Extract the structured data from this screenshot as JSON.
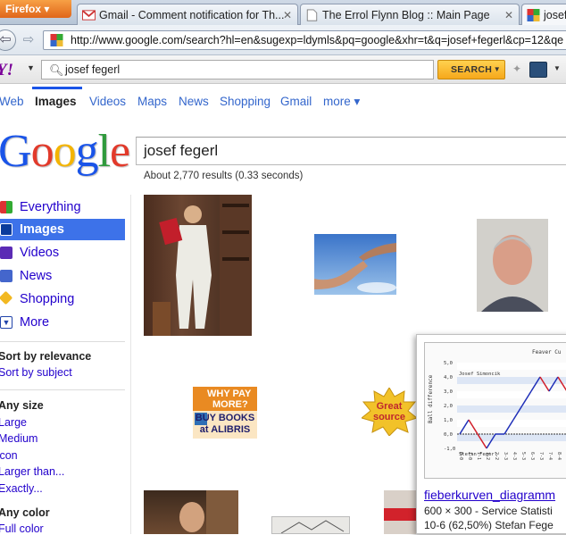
{
  "browser": {
    "app_button": "Firefox",
    "tabs": [
      {
        "label": "Gmail - Comment notification for Th...",
        "icon": "gmail-icon"
      },
      {
        "label": "The Errol Flynn Blog :: Main Page",
        "icon": "page-icon"
      },
      {
        "label": "josef",
        "icon": "google-icon"
      }
    ],
    "url": "http://www.google.com/search?hl=en&sugexp=ldymls&pq=google&xhr=t&q=josef+fegerl&cp=12&qe"
  },
  "yahoo_toolbar": {
    "logo": "Y!",
    "search_value": "josef fegerl",
    "search_button": "SEARCH"
  },
  "google_nav": {
    "items": [
      "Web",
      "Images",
      "Videos",
      "Maps",
      "News",
      "Shopping",
      "Gmail",
      "more ▾"
    ],
    "active": "Images"
  },
  "search": {
    "query": "josef fegerl",
    "stats": "About 2,770 results (0.33 seconds)"
  },
  "left_nav": {
    "types": [
      "Everything",
      "Images",
      "Videos",
      "News",
      "Shopping",
      "More"
    ],
    "sort_heading": "Sort by relevance",
    "sort_link": "Sort by subject",
    "size_heading": "Any size",
    "size_links": [
      "Large",
      "Medium",
      "Icon",
      "Larger than...",
      "Exactly..."
    ],
    "color_heading": "Any color",
    "color_links": [
      "Full color"
    ]
  },
  "results": {
    "ad1_text": [
      "WHY PAY",
      "MORE?",
      "BUY BOOKS",
      "at ALIBRIS"
    ],
    "ad2_text": [
      "Great",
      "source"
    ],
    "popup": {
      "title": "fieberkurven_diagramm",
      "meta": "600 × 300 - Service Statisti",
      "meta2": "10-6 (62,50%) Stefan Fege",
      "chart_title": "Feaver Cu",
      "chart_label1": "Josef Simoncik",
      "chart_label2": "Stefan Fegerl",
      "y_label": "Ball difference",
      "y_ticks": [
        "5,0",
        "4,0",
        "3,0",
        "2,0",
        "1,0",
        "0,0",
        "-1,0"
      ],
      "x_ticks": [
        "0-0",
        "1-0",
        "1-1",
        "1-2",
        "2-2",
        "3-3",
        "4-3",
        "5-3",
        "6-3",
        "7-3",
        "7-4",
        "8-4",
        "8-5",
        "9-5"
      ]
    }
  },
  "colors": {
    "link": "#2200cc",
    "nav_link": "#3366cc",
    "active_nav": "#3d72e9",
    "google_blue": "#1a54e8"
  }
}
